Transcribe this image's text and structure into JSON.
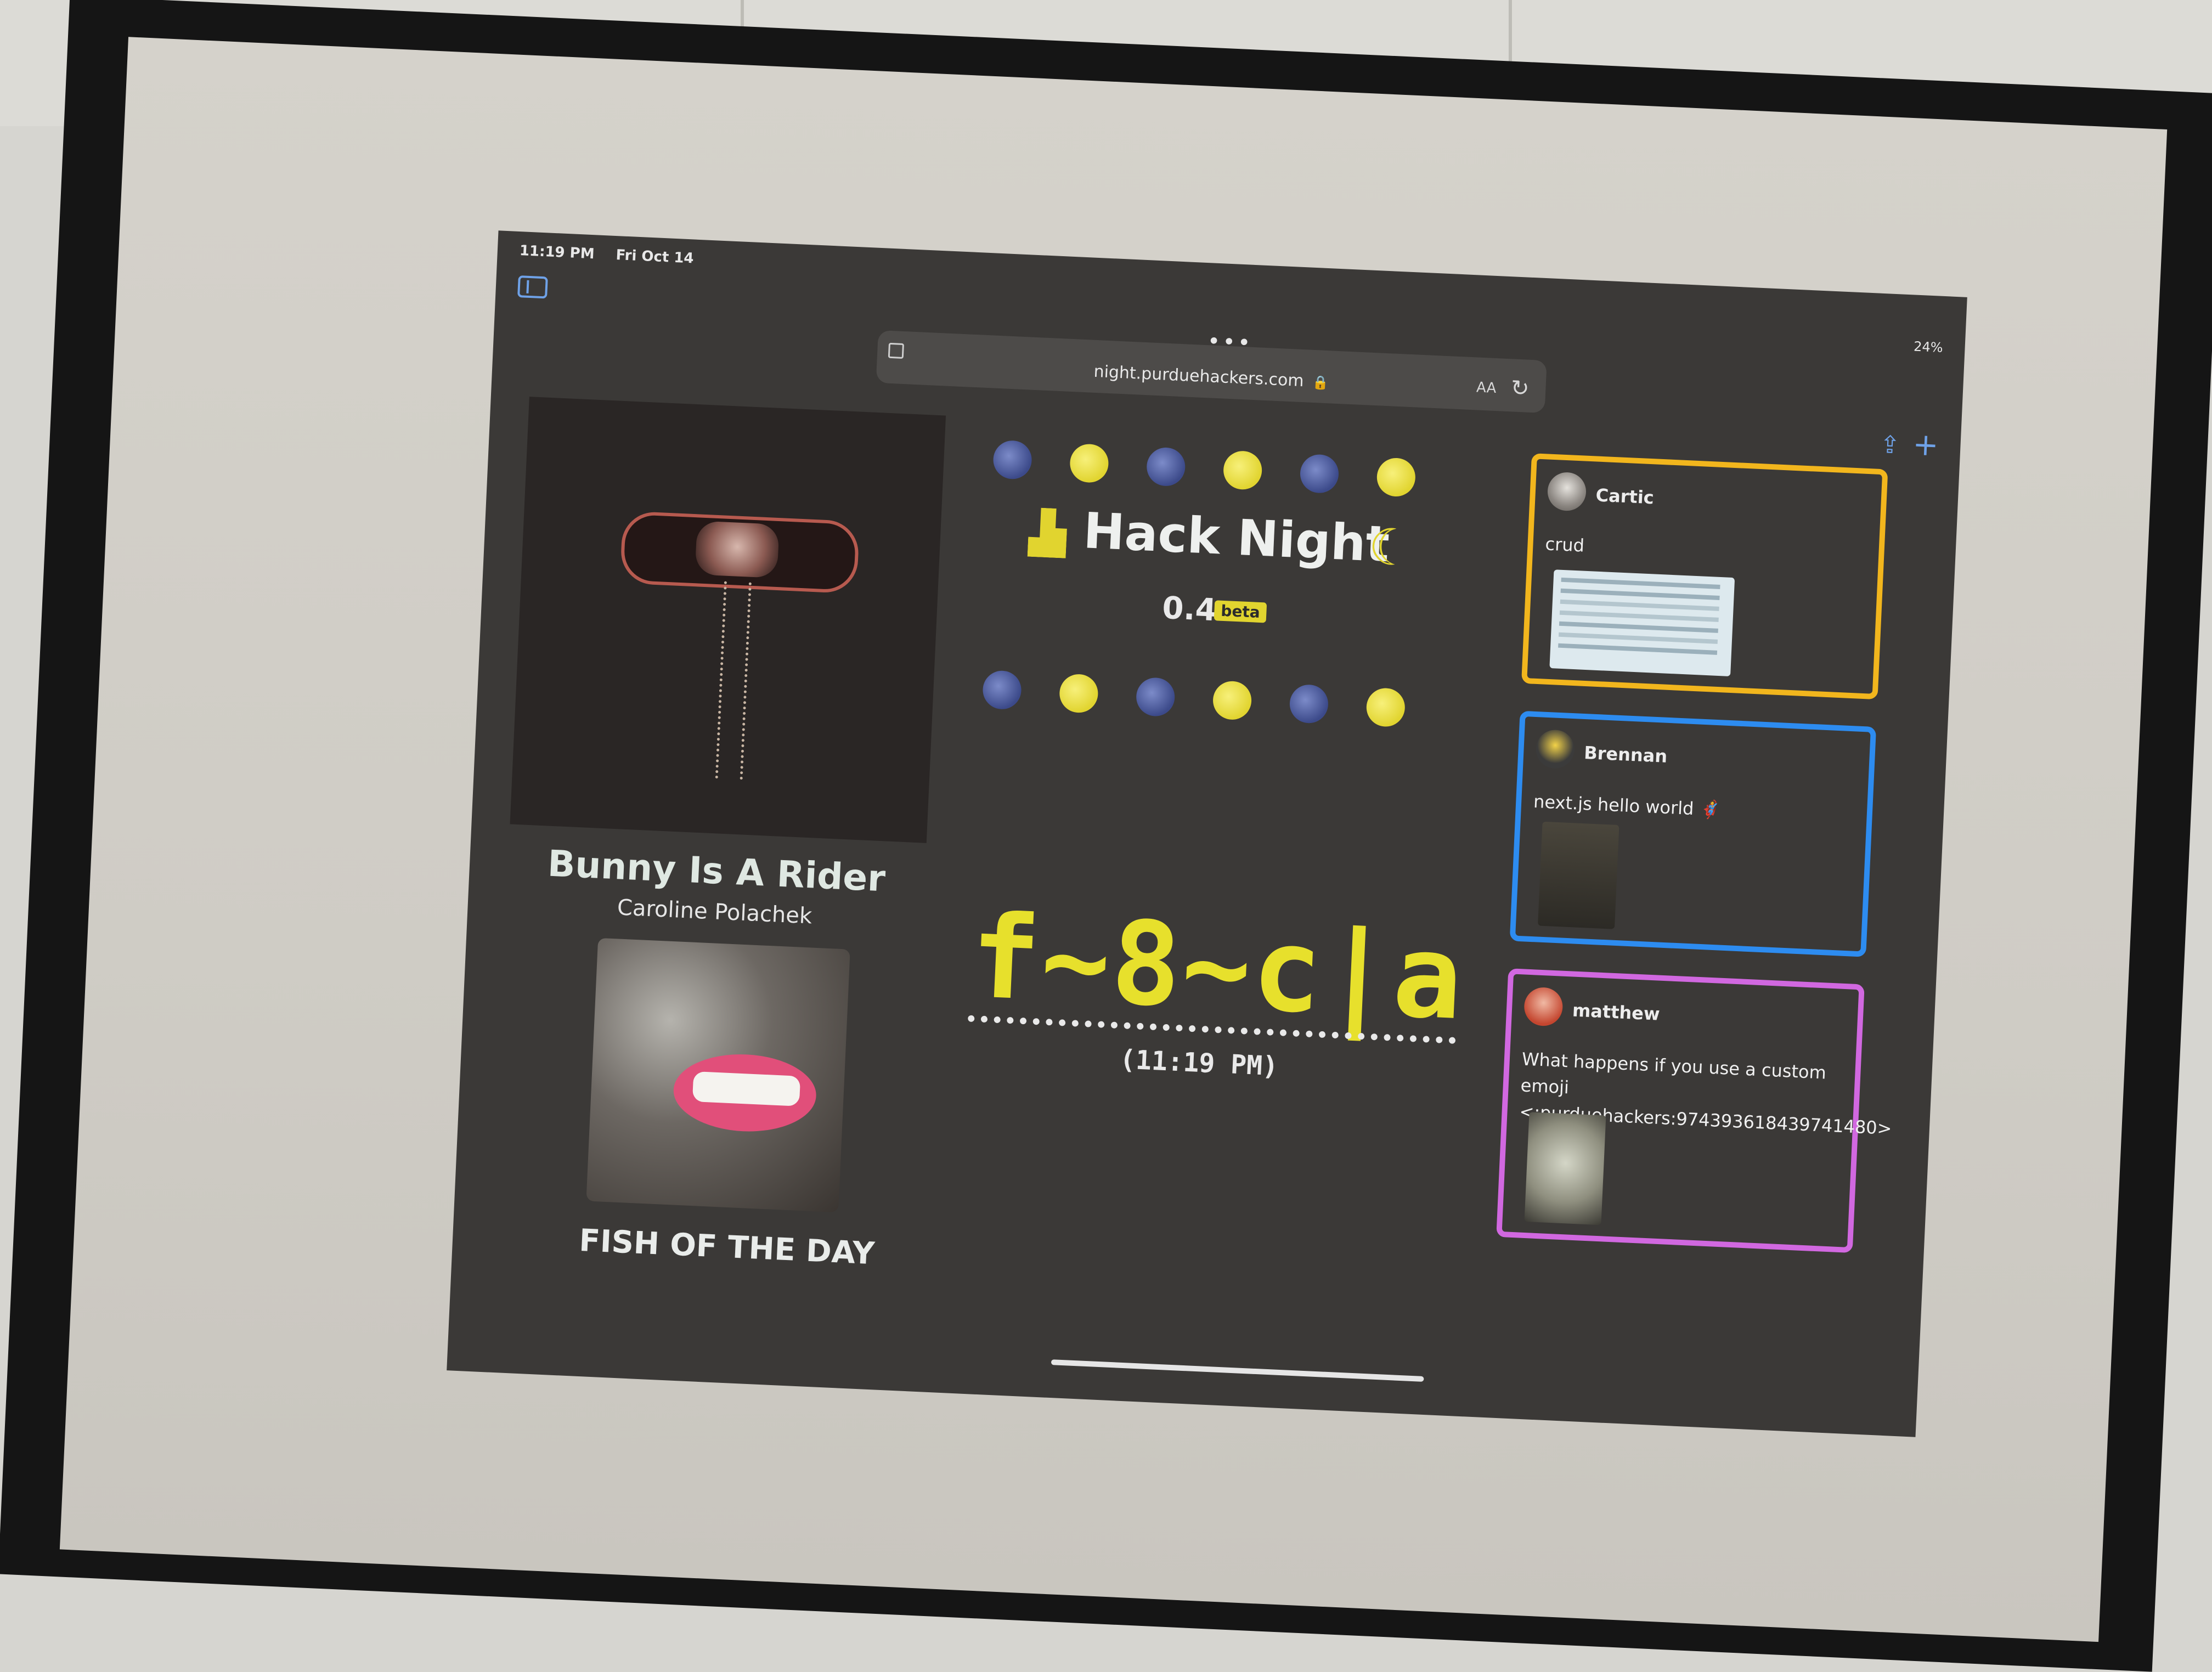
{
  "status_bar": {
    "time": "11:19 PM",
    "date": "Fri Oct 14",
    "battery": "24%"
  },
  "browser": {
    "url": "night.purduehackers.com",
    "text_size_label": "AA"
  },
  "now_playing": {
    "title": "Bunny Is A Rider",
    "artist": "Caroline Polachek"
  },
  "fish": {
    "caption": "FISH OF THE DAY"
  },
  "hack_night": {
    "name": "Hack Night",
    "version": "0.4",
    "badge": "beta",
    "codeword": "f~8~c|a",
    "time": "(11:19 PM)"
  },
  "feed": [
    {
      "user": "Cartic",
      "message": "crud",
      "accent": "#f2b61d"
    },
    {
      "user": "Brennan",
      "message": "next.js hello world 🦸",
      "accent": "#2d8cf0"
    },
    {
      "user": "matthew",
      "message": "What happens if you use a custom emoji <:purduehackers:974393618439741480>",
      "accent": "#d168e0"
    }
  ],
  "icons": {
    "sidebar": "sidebar-icon",
    "share": "share-icon",
    "add": "plus-icon",
    "lock": "lock-icon",
    "reload": "reload-icon",
    "moon": "crescent-moon-icon"
  }
}
